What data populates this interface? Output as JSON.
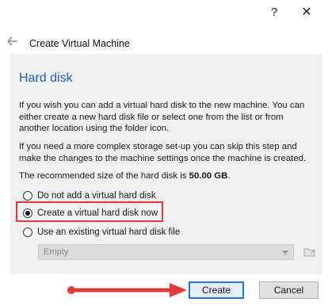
{
  "titlebar": {
    "help_label": "?",
    "close_label": "✕"
  },
  "wizard": {
    "title": "Create Virtual Machine",
    "heading": "Hard disk",
    "paragraph1": "If you wish you can add a virtual hard disk to the new machine. You can either create a new hard disk file or select one from the list or from another location using the folder icon.",
    "paragraph2": "If you need a more complex storage set-up you can skip this step and make the changes to the machine settings once the machine is created.",
    "recommended_prefix": "The recommended size of the hard disk is ",
    "recommended_size": "50.00 GB",
    "recommended_suffix": "."
  },
  "options": [
    {
      "label": "Do not add a virtual hard disk",
      "checked": false
    },
    {
      "label": "Create a virtual hard disk now",
      "checked": true
    },
    {
      "label": "Use an existing virtual hard disk file",
      "checked": false
    }
  ],
  "disk_select": {
    "value": "Empty",
    "enabled": false
  },
  "buttons": {
    "create": "Create",
    "cancel": "Cancel"
  },
  "colors": {
    "heading": "#1f5fb0",
    "highlight": "#e2393b",
    "arrow": "#e2393b",
    "default_button_border": "#2a72d6"
  }
}
